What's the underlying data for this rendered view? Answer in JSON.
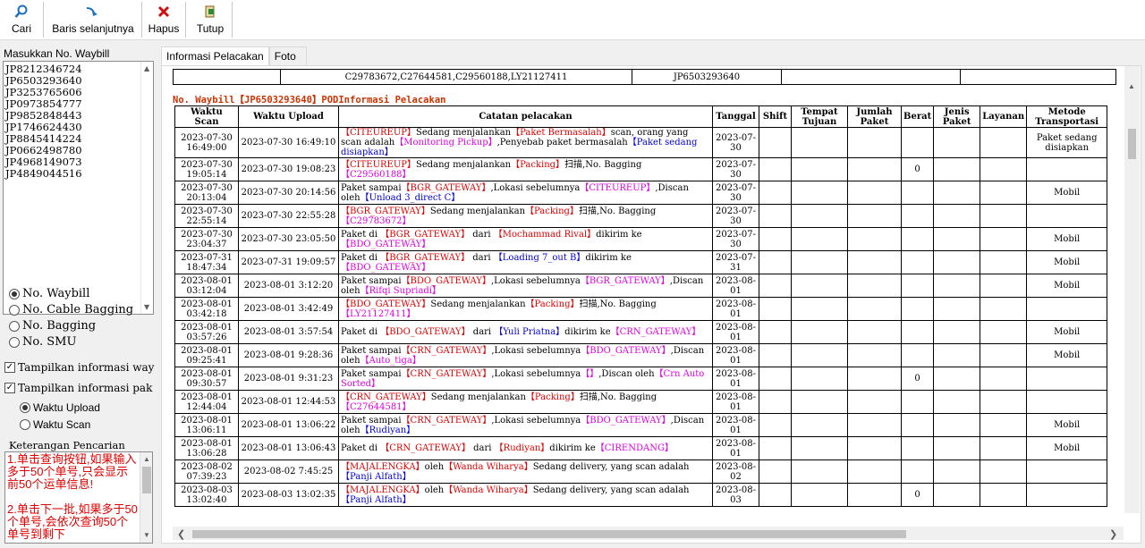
{
  "toolbar": {
    "cari": "Cari",
    "baris": "Baris selanjutnya",
    "hapus": "Hapus",
    "tutup": "Tutup"
  },
  "left": {
    "waybill_label": "Masukkan No. Waybill",
    "waybills": [
      "JP8212346724",
      "JP6503293640",
      "JP3253765606",
      "JP0973854777",
      "JP9852848443",
      "JP1746624430",
      "JP8845414224",
      "JP0662498780",
      "JP4968149073",
      "JP4849044516"
    ],
    "radios": [
      "No. Waybill",
      "No. Cable Bagging",
      "No. Bagging",
      "No. SMU"
    ],
    "check1": "Tampilkan informasi way",
    "check2": "Tampilkan informasi pak",
    "sub1": "Waktu Upload",
    "sub2": "Waktu Scan",
    "ket_label": "Keterangan Pencarian",
    "ket_text1": "1.单击查询按钮,如果输入多于50个单号,只会显示前50个运单信息!",
    "ket_text2": "2.单击下一批,如果多于50个单号,会依次查询50个单号到剩下"
  },
  "tabs": [
    "Informasi Pelacakan",
    "Foto"
  ],
  "top_row": {
    "bagging": "C29783672,C27644581,C29560188,LY21127411",
    "waybill": "JP6503293640"
  },
  "section_title": "No. Waybill【JP6503293640】PODInformasi Pelacakan",
  "headers": [
    "Waktu Scan",
    "Waktu Upload",
    "Catatan pelacakan",
    "Tanggal",
    "Shift",
    "Tempat Tujuan",
    "Jumlah Paket",
    "Berat",
    "Jenis Paket",
    "Layanan",
    "Metode Transportasi"
  ],
  "rows": [
    {
      "scan": "2023-07-30 16:49:00",
      "upload": "2023-07-30 16:49:10",
      "tgl": "2023-07-30",
      "berat": "",
      "metode": "Paket sedang disiapkan",
      "note": [
        [
          "br",
          "【CITEUREUP】"
        ],
        [
          "",
          "Sedang menjalankan"
        ],
        [
          "r",
          "【Paket Bermasalah】"
        ],
        [
          "",
          "scan, orang yang scan adalah"
        ],
        [
          "m",
          "【Monitoring Pickup】"
        ],
        [
          "",
          ",Penyebab paket bermasalah"
        ],
        [
          "b",
          "【Paket sedang disiapkan】"
        ]
      ]
    },
    {
      "scan": "2023-07-30 19:05:14",
      "upload": "2023-07-30 19:08:23",
      "tgl": "2023-07-30",
      "berat": "0",
      "metode": "",
      "note": [
        [
          "br",
          "【CITEUREUP】"
        ],
        [
          "",
          "Sedang menjalankan"
        ],
        [
          "r",
          "【Packing】"
        ],
        [
          "",
          "扫描,No. Bagging"
        ],
        [
          "m",
          "【C29560188】"
        ]
      ]
    },
    {
      "scan": "2023-07-30 20:13:04",
      "upload": "2023-07-30 20:14:56",
      "tgl": "2023-07-30",
      "berat": "",
      "metode": "Mobil",
      "note": [
        [
          "",
          "Paket sampai"
        ],
        [
          "r",
          "【BGR_GATEWAY】"
        ],
        [
          "",
          ",Lokasi sebelumnya"
        ],
        [
          "m",
          "【CITEUREUP】"
        ],
        [
          "",
          ",Discan oleh"
        ],
        [
          "b",
          "【Unload 3_direct C】"
        ]
      ]
    },
    {
      "scan": "2023-07-30 22:55:14",
      "upload": "2023-07-30 22:55:28",
      "tgl": "2023-07-30",
      "berat": "",
      "metode": "",
      "note": [
        [
          "br",
          "【BGR_GATEWAY】"
        ],
        [
          "",
          "Sedang menjalankan"
        ],
        [
          "r",
          "【Packing】"
        ],
        [
          "",
          "扫描,No. Bagging"
        ],
        [
          "m",
          "【C29783672】"
        ]
      ]
    },
    {
      "scan": "2023-07-30 23:04:37",
      "upload": "2023-07-30 23:05:50",
      "tgl": "2023-07-30",
      "berat": "",
      "metode": "Mobil",
      "note": [
        [
          "",
          "Paket di "
        ],
        [
          "r",
          "【BGR_GATEWAY】"
        ],
        [
          "",
          " dari "
        ],
        [
          "r",
          "【Mochammad Rival】"
        ],
        [
          "",
          "dikirim ke"
        ],
        [
          "m",
          "【BDO_GATEWAY】"
        ]
      ]
    },
    {
      "scan": "2023-07-31 18:47:34",
      "upload": "2023-07-31 19:09:57",
      "tgl": "2023-07-31",
      "berat": "",
      "metode": "Mobil",
      "note": [
        [
          "",
          "Paket di "
        ],
        [
          "r",
          "【BGR_GATEWAY】"
        ],
        [
          "",
          " dari "
        ],
        [
          "b",
          "【Loading 7_out B】"
        ],
        [
          "",
          "dikirim ke"
        ],
        [
          "m",
          "【BDO_GATEWAY】"
        ]
      ]
    },
    {
      "scan": "2023-08-01 03:12:04",
      "upload": "2023-08-01 3:12:20",
      "tgl": "2023-08-01",
      "berat": "",
      "metode": "Mobil",
      "note": [
        [
          "",
          "Paket sampai"
        ],
        [
          "r",
          "【BDO_GATEWAY】"
        ],
        [
          "",
          ",Lokasi sebelumnya"
        ],
        [
          "m",
          "【BGR_GATEWAY】"
        ],
        [
          "",
          ",Discan oleh"
        ],
        [
          "m",
          "【Rifqi Supriadi】"
        ]
      ]
    },
    {
      "scan": "2023-08-01 03:42:18",
      "upload": "2023-08-01 3:42:49",
      "tgl": "2023-08-01",
      "berat": "",
      "metode": "",
      "note": [
        [
          "br",
          "【BDO_GATEWAY】"
        ],
        [
          "",
          "Sedang menjalankan"
        ],
        [
          "r",
          "【Packing】"
        ],
        [
          "",
          "扫描,No. Bagging"
        ],
        [
          "m",
          "【LY21127411】"
        ]
      ]
    },
    {
      "scan": "2023-08-01 03:57:26",
      "upload": "2023-08-01 3:57:54",
      "tgl": "2023-08-01",
      "berat": "",
      "metode": "Mobil",
      "note": [
        [
          "",
          "Paket di "
        ],
        [
          "r",
          "【BDO_GATEWAY】"
        ],
        [
          "",
          " dari "
        ],
        [
          "b",
          "【Yuli Priatna】"
        ],
        [
          "",
          "dikirim ke"
        ],
        [
          "m",
          "【CRN_GATEWAY】"
        ]
      ]
    },
    {
      "scan": "2023-08-01 09:25:41",
      "upload": "2023-08-01 9:28:36",
      "tgl": "2023-08-01",
      "berat": "",
      "metode": "Mobil",
      "note": [
        [
          "",
          "Paket sampai"
        ],
        [
          "r",
          "【CRN_GATEWAY】"
        ],
        [
          "",
          ",Lokasi sebelumnya"
        ],
        [
          "m",
          "【BDO_GATEWAY】"
        ],
        [
          "",
          ",Discan oleh"
        ],
        [
          "m",
          "【Auto_tiga】"
        ]
      ]
    },
    {
      "scan": "2023-08-01 09:30:57",
      "upload": "2023-08-01 9:31:23",
      "tgl": "2023-08-01",
      "berat": "0",
      "metode": "",
      "note": [
        [
          "",
          "Paket sampai"
        ],
        [
          "r",
          "【CRN_GATEWAY】"
        ],
        [
          "",
          ",Lokasi sebelumnya"
        ],
        [
          "m",
          "【】"
        ],
        [
          "",
          ",Discan oleh"
        ],
        [
          "m",
          "【Crn Auto Sorted】"
        ]
      ]
    },
    {
      "scan": "2023-08-01 12:44:04",
      "upload": "2023-08-01 12:44:53",
      "tgl": "2023-08-01",
      "berat": "",
      "metode": "",
      "note": [
        [
          "br",
          "【CRN_GATEWAY】"
        ],
        [
          "",
          "Sedang menjalankan"
        ],
        [
          "r",
          "【Packing】"
        ],
        [
          "",
          "扫描,No. Bagging"
        ],
        [
          "m",
          "【C27644581】"
        ]
      ]
    },
    {
      "scan": "2023-08-01 13:06:11",
      "upload": "2023-08-01 13:06:22",
      "tgl": "2023-08-01",
      "berat": "",
      "metode": "Mobil",
      "note": [
        [
          "",
          "Paket sampai"
        ],
        [
          "r",
          "【CRN_GATEWAY】"
        ],
        [
          "",
          ",Lokasi sebelumnya"
        ],
        [
          "m",
          "【BDO_GATEWAY】"
        ],
        [
          "",
          ",Discan oleh"
        ],
        [
          "b",
          "【Rudiyan】"
        ]
      ]
    },
    {
      "scan": "2023-08-01 13:06:28",
      "upload": "2023-08-01 13:06:43",
      "tgl": "2023-08-01",
      "berat": "",
      "metode": "Mobil",
      "note": [
        [
          "",
          "Paket di "
        ],
        [
          "r",
          "【CRN_GATEWAY】"
        ],
        [
          "",
          " dari "
        ],
        [
          "r",
          "【Rudiyan】"
        ],
        [
          "",
          "dikirim ke"
        ],
        [
          "m",
          "【CIRENDANG】"
        ]
      ]
    },
    {
      "scan": "2023-08-02 07:39:23",
      "upload": "2023-08-02 7:45:25",
      "tgl": "2023-08-02",
      "berat": "",
      "metode": "",
      "note": [
        [
          "br",
          "【MAJALENGKA】"
        ],
        [
          "",
          "oleh"
        ],
        [
          "r",
          "【Wanda Wiharya】"
        ],
        [
          "",
          "Sedang delivery, yang scan adalah"
        ],
        [
          "b",
          "【Panji Alfath】"
        ]
      ]
    },
    {
      "scan": "2023-08-03 13:02:40",
      "upload": "2023-08-03 13:02:35",
      "tgl": "2023-08-03",
      "berat": "0",
      "metode": "",
      "note": [
        [
          "br",
          "【MAJALENGKA】"
        ],
        [
          "",
          "oleh"
        ],
        [
          "r",
          "【Wanda Wiharya】"
        ],
        [
          "",
          "Sedang delivery, yang scan adalah"
        ],
        [
          "b",
          "【Panji Alfath】"
        ]
      ]
    }
  ]
}
